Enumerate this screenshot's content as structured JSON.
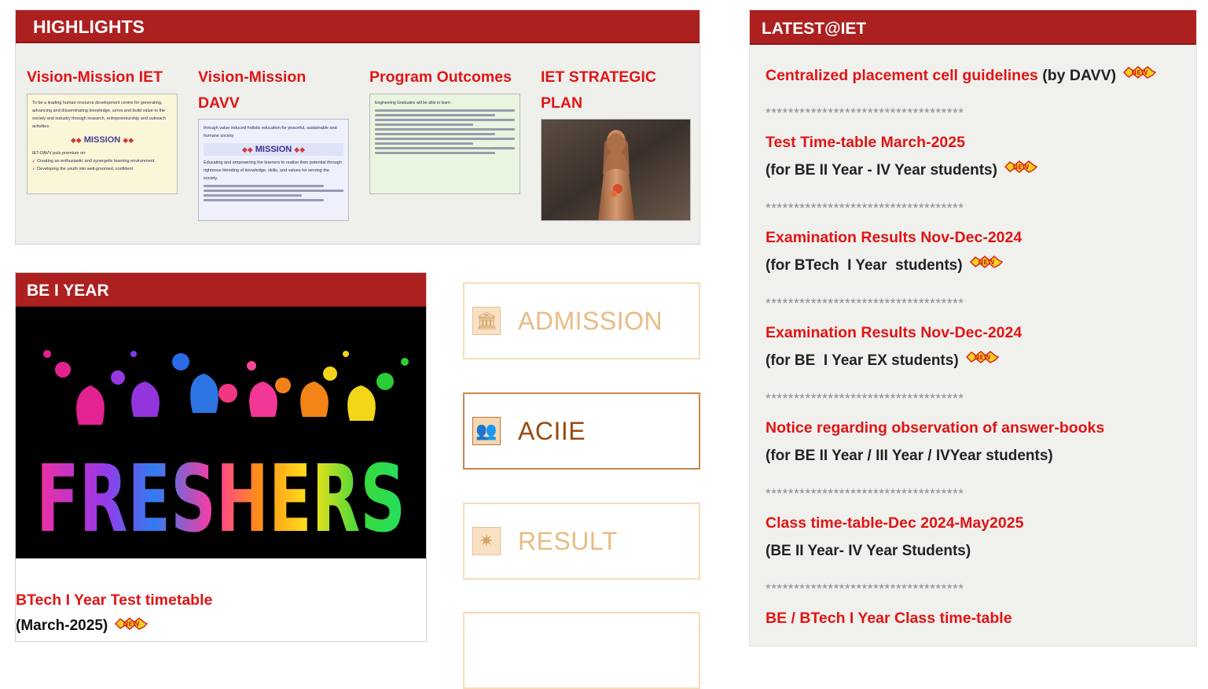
{
  "highlights": {
    "header": "HIGHLIGHTS",
    "items": [
      {
        "title_lines": [
          "Vision-Mission IET"
        ]
      },
      {
        "title_lines": [
          "Vision-Mission",
          "DAVV"
        ]
      },
      {
        "title_lines": [
          "Program Outcomes"
        ]
      },
      {
        "title_lines": [
          "IET STRATEGIC",
          "PLAN"
        ]
      }
    ],
    "thumb1": {
      "intro": "To be a leading human resource development centre for generating, advancing and disseminating knowledge, serve and build value to the society and industry through research, entrepreneurship and outreach activities.",
      "mission": "MISSION",
      "sub": "IET-DAVV puts premium on:",
      "b1": "Creating an enthusiastic and synergetic learning environment.",
      "b2": "Developing the youth into well-groomed, confident"
    },
    "thumb2": {
      "intro": "through value induced holistic education for peaceful, sustainable and humane society",
      "mission": "MISSION",
      "body": "Educating and empowering the learners to realise their potential through righteous blending of knowledge, skills, and values for serving the society."
    },
    "thumb3": {
      "intro": "Engineering Graduates will be able to learn:"
    }
  },
  "beiyear": {
    "header": "BE I YEAR",
    "image_text": "FRESHERS",
    "link": "BTech I Year Test timetable",
    "sub": "(March-2025)"
  },
  "side_buttons": [
    {
      "label": "ADMISSION",
      "icon": "institution-icon",
      "active": false
    },
    {
      "label": "ACIIE",
      "icon": "users-icon",
      "active": true
    },
    {
      "label": "RESULT",
      "icon": "sun-icon",
      "active": false
    }
  ],
  "latest": {
    "header": "LATEST@IET",
    "separator": "***********************************",
    "items": [
      {
        "title": "Centralized placement cell guidelines",
        "title_suffix": " (by DAVV)",
        "sub": "",
        "new": true
      },
      {
        "title": "Test Time-table March-2025",
        "sub": "(for BE II Year - IV Year students)",
        "new": true
      },
      {
        "title": "Examination Results Nov-Dec-2024",
        "sub": "(for BTech  I Year  students)",
        "new": true
      },
      {
        "title": "Examination Results Nov-Dec-2024",
        "sub": "(for BE  I Year EX students)",
        "new": true
      },
      {
        "title": "Notice regarding observation of answer-books",
        "sub": "(for BE II Year / III Year / IVYear students)",
        "new": false
      },
      {
        "title": "Class time-table-Dec 2024-May2025",
        "sub": "(BE II Year- IV Year Students)",
        "new": false
      },
      {
        "title": "BE / BTech I Year Class time-table",
        "sub": "",
        "new": false
      }
    ]
  }
}
